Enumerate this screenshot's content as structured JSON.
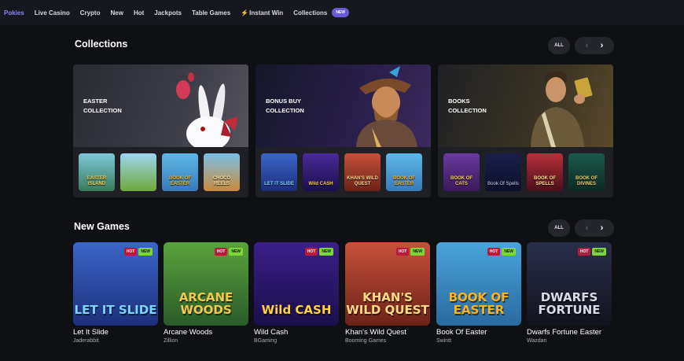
{
  "nav": {
    "items": [
      {
        "label": "Pokies",
        "active": true
      },
      {
        "label": "Live Casino"
      },
      {
        "label": "Crypto"
      },
      {
        "label": "New"
      },
      {
        "label": "Hot"
      },
      {
        "label": "Jackpots"
      },
      {
        "label": "Table Games"
      },
      {
        "label": "Instant Win",
        "icon": "lightning-icon"
      },
      {
        "label": "Collections",
        "badge": "NEW"
      }
    ]
  },
  "collections": {
    "title": "Collections",
    "all_label": "ALL",
    "cards": [
      {
        "title_line1": "EASTER",
        "title_line2": "COLLECTION",
        "hero_icon": "bunny-icon",
        "thumbs": [
          "EASTER ISLAND",
          "",
          "BOOK OF EASTER",
          "CHOCO REELS"
        ]
      },
      {
        "title_line1": "BONUS BUY",
        "title_line2": "COLLECTION",
        "hero_icon": "pirate-icon",
        "thumbs": [
          "LET IT SLIDE",
          "Wild CASH",
          "KHAN'S WILD QUEST",
          "BOOK OF EASTER"
        ]
      },
      {
        "title_line1": "BOOKS",
        "title_line2": "COLLECTION",
        "hero_icon": "explorer-icon",
        "thumbs": [
          "BOOK OF CATS",
          "Book Of Spells",
          "BOOK OF SPELLS",
          "BOOK OF DIVINES"
        ]
      }
    ]
  },
  "new_games": {
    "title": "New Games",
    "all_label": "ALL",
    "hot_label": "HOT",
    "new_label": "NEW",
    "games": [
      {
        "name": "Let It Slide",
        "provider": "Jaderabbit",
        "art": "LET IT SLIDE",
        "colors": [
          "#3a66c9",
          "#1d2f7a"
        ],
        "art_color": "#7fd4ff"
      },
      {
        "name": "Arcane Woods",
        "provider": "Zillion",
        "art": "ARCANE WOODS",
        "colors": [
          "#5aa33c",
          "#2b5a2a"
        ],
        "art_color": "#f2c94c"
      },
      {
        "name": "Wild Cash",
        "provider": "BGaming",
        "art": "Wild CASH",
        "colors": [
          "#3a1f8a",
          "#1a0f4a"
        ],
        "art_color": "#ffd23f"
      },
      {
        "name": "Khan's Wild Quest",
        "provider": "Booming Games",
        "art": "KHAN'S WILD QUEST",
        "colors": [
          "#c8503a",
          "#6b2318"
        ],
        "art_color": "#ffd98a"
      },
      {
        "name": "Book Of Easter",
        "provider": "Swintt",
        "art": "BOOK OF EASTER",
        "colors": [
          "#4aa4d9",
          "#2a6aa0"
        ],
        "art_color": "#ffb21e"
      },
      {
        "name": "Dwarfs Fortune Easter",
        "provider": "Wazdan",
        "art": "DWARFS FORTUNE",
        "colors": [
          "#2a2f4a",
          "#12131d"
        ],
        "art_color": "#d8dbe6"
      }
    ]
  }
}
